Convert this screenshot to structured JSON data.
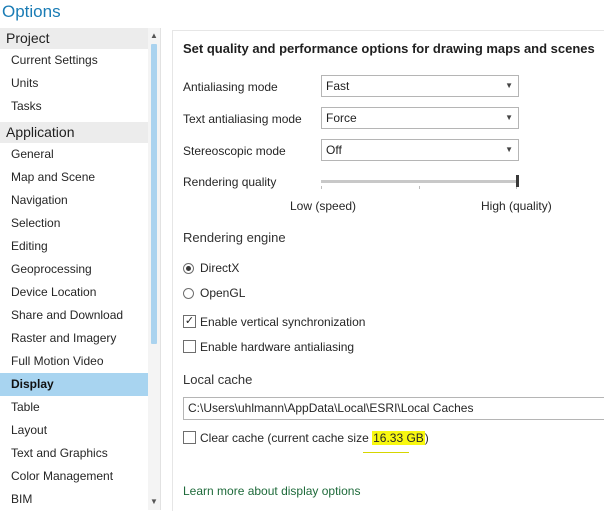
{
  "window": {
    "title": "Options"
  },
  "nav": {
    "groups": [
      {
        "label": "Project",
        "items": [
          "Current Settings",
          "Units",
          "Tasks"
        ]
      },
      {
        "label": "Application",
        "items": [
          "General",
          "Map and Scene",
          "Navigation",
          "Selection",
          "Editing",
          "Geoprocessing",
          "Device Location",
          "Share and Download",
          "Raster and Imagery",
          "Full Motion Video",
          "Display",
          "Table",
          "Layout",
          "Text and Graphics",
          "Color Management",
          "BIM"
        ]
      }
    ],
    "selected": "Display"
  },
  "display": {
    "heading": "Set quality and performance options for drawing maps and scenes",
    "antialiasing": {
      "label": "Antialiasing mode",
      "value": "Fast"
    },
    "text_antialiasing": {
      "label": "Text antialiasing mode",
      "value": "Force"
    },
    "stereoscopic": {
      "label": "Stereoscopic mode",
      "value": "Off"
    },
    "rendering_quality": {
      "label": "Rendering quality",
      "low_label": "Low (speed)",
      "high_label": "High (quality)",
      "level": 1.0
    },
    "rendering_engine": {
      "title": "Rendering engine",
      "options": [
        {
          "label": "DirectX",
          "checked": true
        },
        {
          "label": "OpenGL",
          "checked": false
        }
      ]
    },
    "checkboxes": [
      {
        "label": "Enable vertical synchronization",
        "checked": true
      },
      {
        "label": "Enable hardware antialiasing",
        "checked": false
      }
    ],
    "local_cache": {
      "title": "Local cache",
      "path": "C:\\Users\\uhlmann\\AppData\\Local\\ESRI\\Local Caches",
      "clear_label": "Clear cache",
      "size_prefix": "(current cache size ",
      "size_value": "16.33 GB",
      "size_suffix": ")",
      "clear_checked": false
    },
    "learn_more": "Learn more about display options"
  },
  "colors": {
    "title": "#1a7cb5",
    "selected_nav": "#a8d4f0",
    "highlight": "#f8f810",
    "link": "#1e6a3a"
  }
}
